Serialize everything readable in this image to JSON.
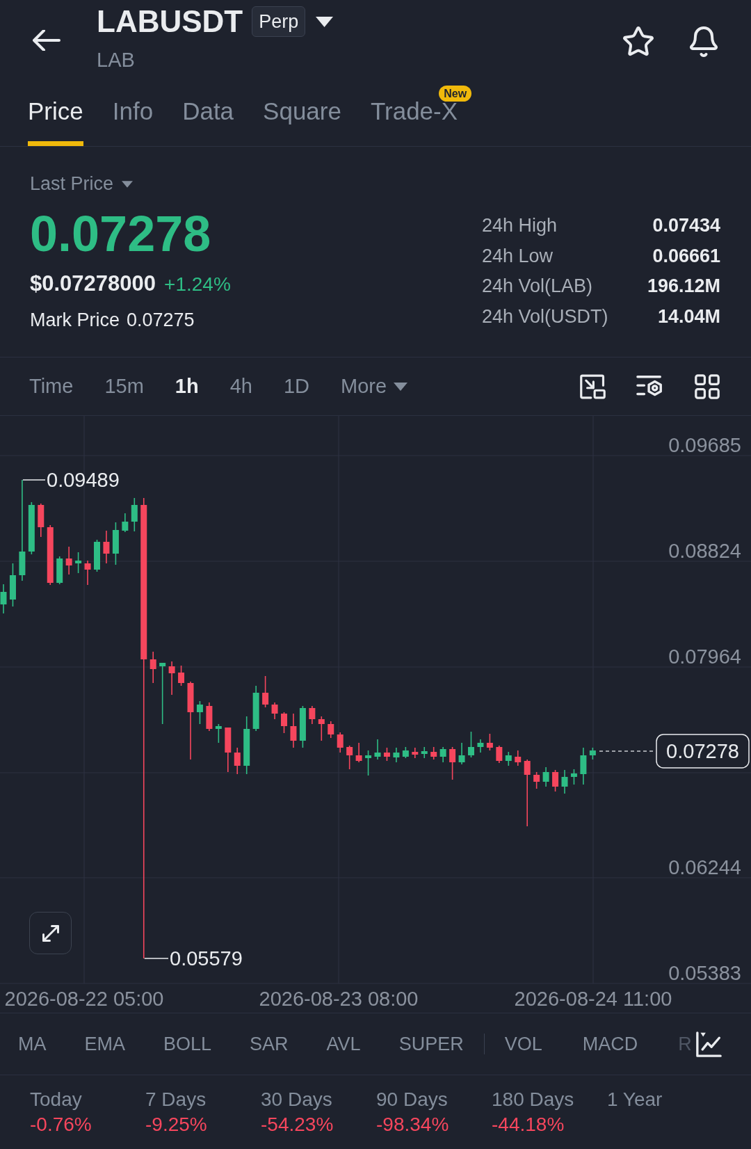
{
  "header": {
    "symbol": "LABUSDT",
    "contract_badge": "Perp",
    "base_asset": "LAB"
  },
  "tabs": [
    {
      "label": "Price",
      "selected": true
    },
    {
      "label": "Info",
      "selected": false
    },
    {
      "label": "Data",
      "selected": false
    },
    {
      "label": "Square",
      "selected": false
    },
    {
      "label": "Trade-X",
      "selected": false,
      "badge": "New"
    }
  ],
  "price": {
    "label": "Last Price",
    "last": "0.07278",
    "usd": "$0.07278000",
    "change": "+1.24%",
    "mark_label": "Mark Price",
    "mark_value": "0.07275"
  },
  "stats": [
    {
      "label": "24h High",
      "value": "0.07434"
    },
    {
      "label": "24h Low",
      "value": "0.06661"
    },
    {
      "label": "24h Vol(LAB)",
      "value": "196.12M"
    },
    {
      "label": "24h Vol(USDT)",
      "value": "14.04M"
    }
  ],
  "intervals": [
    {
      "label": "Time",
      "selected": false
    },
    {
      "label": "15m",
      "selected": false
    },
    {
      "label": "1h",
      "selected": true
    },
    {
      "label": "4h",
      "selected": false
    },
    {
      "label": "1D",
      "selected": false
    }
  ],
  "more": {
    "label": "More"
  },
  "chart": {
    "price_axis": [
      "0.09685",
      "0.08824",
      "0.07964",
      "0.06244",
      "0.05383"
    ],
    "time_axis": [
      "2026-08-22 05:00",
      "2026-08-23 08:00",
      "2026-08-24 11:00"
    ],
    "high_marker": "0.09489",
    "low_marker": "0.05579",
    "current_price_tag": "0.07278"
  },
  "indicators": {
    "main": [
      "MA",
      "EMA",
      "BOLL",
      "SAR",
      "AVL",
      "SUPER"
    ],
    "sub": [
      "VOL",
      "MACD",
      "R"
    ]
  },
  "performance": [
    {
      "label": "Today",
      "change": "-0.76%"
    },
    {
      "label": "7 Days",
      "change": "-9.25%"
    },
    {
      "label": "30 Days",
      "change": "-54.23%"
    },
    {
      "label": "90 Days",
      "change": "-98.34%"
    },
    {
      "label": "180 Days",
      "change": "-44.18%"
    },
    {
      "label": "1 Year"
    }
  ]
}
